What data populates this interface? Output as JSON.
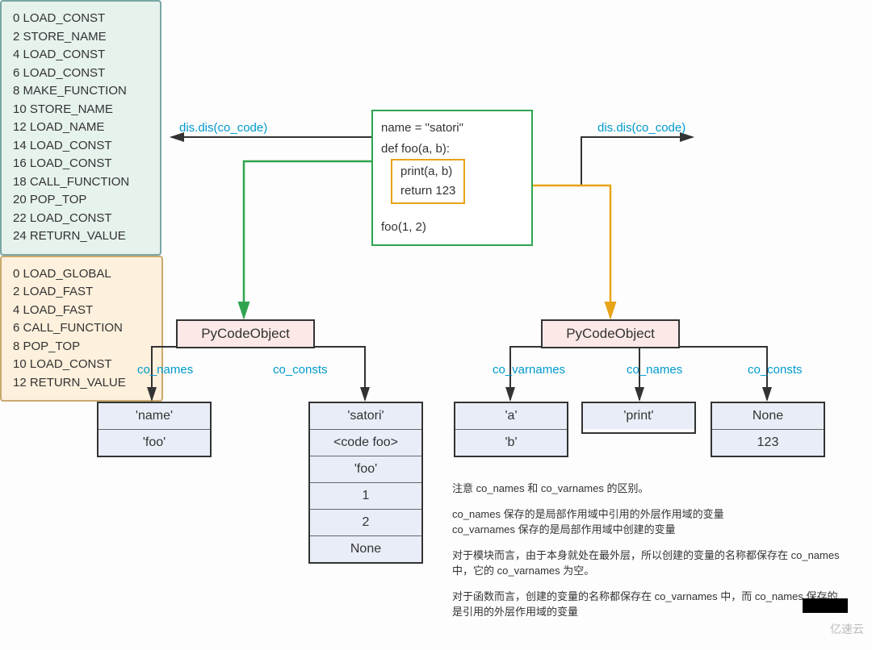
{
  "opcodesLeft": [
    "0 LOAD_CONST",
    "2 STORE_NAME",
    "4 LOAD_CONST",
    "6 LOAD_CONST",
    "8 MAKE_FUNCTION",
    "10 STORE_NAME",
    "12 LOAD_NAME",
    "14 LOAD_CONST",
    "16 LOAD_CONST",
    "18 CALL_FUNCTION",
    "20 POP_TOP",
    "22 LOAD_CONST",
    "24 RETURN_VALUE"
  ],
  "opcodesRight": [
    "0 LOAD_GLOBAL",
    "2 LOAD_FAST",
    "4 LOAD_FAST",
    "6 CALL_FUNCTION",
    "8 POP_TOP",
    "10 LOAD_CONST",
    "12 RETURN_VALUE"
  ],
  "source": {
    "line1": "name = \"satori\"",
    "line2": "def foo(a, b):",
    "inner1": "print(a, b)",
    "inner2": "return 123",
    "line3": "foo(1, 2)"
  },
  "labels": {
    "disLeft": "dis.dis(co_code)",
    "disRight": "dis.dis(co_code)",
    "pycLeft": "PyCodeObject",
    "pycRight": "PyCodeObject",
    "coNamesLeft": "co_names",
    "coConstsLeft": "co_consts",
    "coVarnames": "co_varnames",
    "coNamesRight": "co_names",
    "coConstsRight": "co_consts"
  },
  "tables": {
    "namesLeft": [
      "'name'",
      "'foo'"
    ],
    "constsLeft": [
      "'satori'",
      "<code foo>",
      "'foo'",
      "1",
      "2",
      "None"
    ],
    "varnames": [
      "'a'",
      "'b'"
    ],
    "namesRight": [
      "'print'"
    ],
    "constsRight": [
      "None",
      "123"
    ]
  },
  "notes": {
    "p1": "注意 co_names 和 co_varnames 的区别。",
    "p2": "co_names 保存的是局部作用域中引用的外层作用域的变量\nco_varnames 保存的是局部作用域中创建的变量",
    "p3": "对于模块而言，由于本身就处在最外层，所以创建的变量的名称都保存在 co_names 中，它的 co_varnames 为空。",
    "p4": "对于函数而言，创建的变量的名称都保存在 co_varnames 中，而 co_names 保存的是引用的外层作用域的变量"
  },
  "watermark": "亿速云"
}
